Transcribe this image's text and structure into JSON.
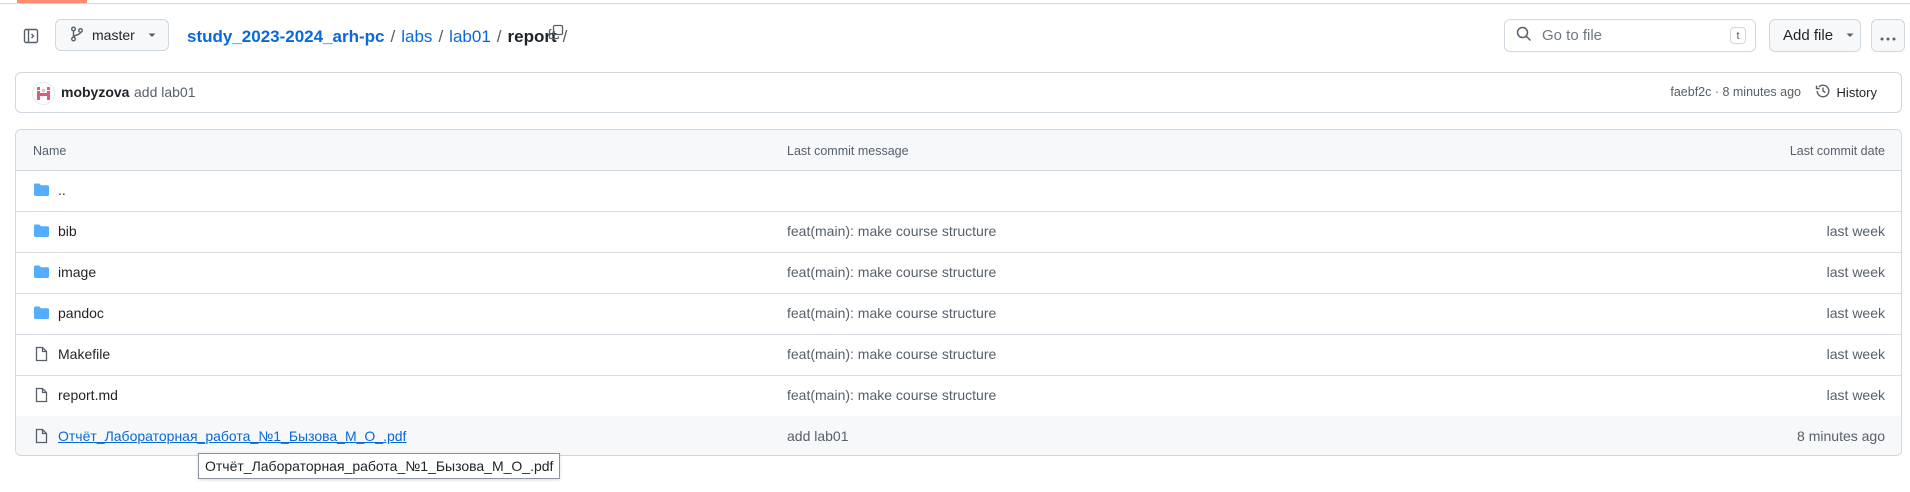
{
  "header": {
    "branch": "master",
    "breadcrumb": {
      "repo": "study_2023-2024_arh-pc",
      "sep1": "/",
      "labs": "labs",
      "sep2": "/",
      "lab01": "lab01",
      "sep3": "/",
      "current": "report",
      "sep4": "/"
    },
    "search_placeholder": "Go to file",
    "search_shortcut": "t",
    "add_file": "Add file"
  },
  "commit": {
    "author": "mobyzova",
    "message": "add lab01",
    "meta": "faebf2c · 8 minutes ago",
    "history": "History"
  },
  "table": {
    "headers": {
      "name": "Name",
      "message": "Last commit message",
      "date": "Last commit date"
    },
    "parent": "..",
    "rows": [
      {
        "name": "bib",
        "type": "dir",
        "message": "feat(main): make course structure",
        "date": "last week"
      },
      {
        "name": "image",
        "type": "dir",
        "message": "feat(main): make course structure",
        "date": "last week"
      },
      {
        "name": "pandoc",
        "type": "dir",
        "message": "feat(main): make course structure",
        "date": "last week"
      },
      {
        "name": "Makefile",
        "type": "file",
        "message": "feat(main): make course structure",
        "date": "last week"
      },
      {
        "name": "report.md",
        "type": "file",
        "message": "feat(main): make course structure",
        "date": "last week"
      },
      {
        "name": "Отчёт_Лабораторная_работа_№1_Бызова_М_О_.pdf",
        "type": "file",
        "message": "add lab01",
        "date": "8 minutes ago"
      }
    ]
  },
  "tooltip": "Отчёт_Лабораторная_работа_№1_Бызова_М_О_.pdf",
  "colors": {
    "link": "#0969da",
    "folder": "#54aeff",
    "accent": "#fd8c73"
  }
}
